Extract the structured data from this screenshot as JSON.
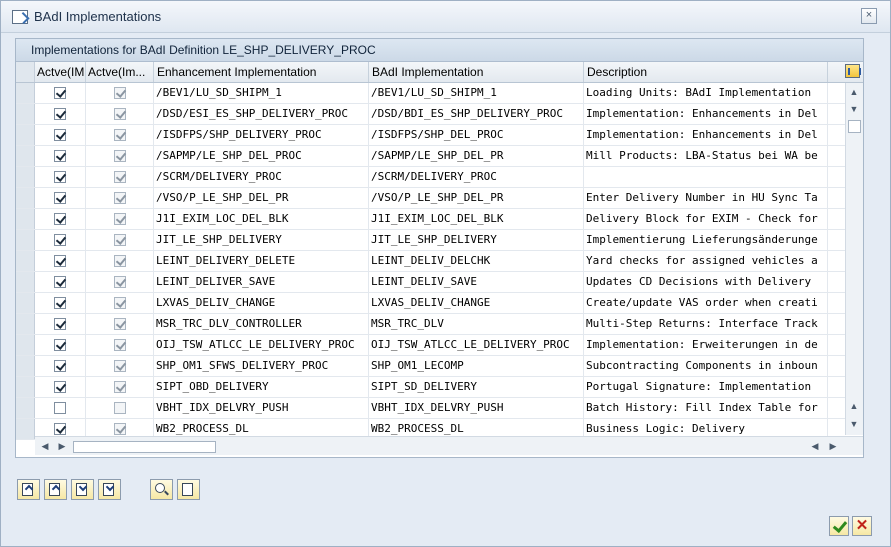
{
  "window": {
    "title": "BAdI Implementations",
    "close_label": "×"
  },
  "panel": {
    "header": "Implementations for BAdI Definition LE_SHP_DELIVERY_PROC"
  },
  "columns": {
    "active_img": "Actve(IMG)",
    "active_im": "Actve(Im...",
    "enhancement": "Enhancement Implementation",
    "badi": "BAdI Implementation",
    "description": "Description"
  },
  "rows": [
    {
      "img": true,
      "im": true,
      "enh": "/BEV1/LU_SD_SHIPM_1",
      "badi": "/BEV1/LU_SD_SHIPM_1",
      "desc": "Loading Units: BAdI Implementation"
    },
    {
      "img": true,
      "im": true,
      "enh": "/DSD/ESI_ES_SHP_DELIVERY_PROC",
      "badi": "/DSD/BDI_ES_SHP_DELIVERY_PROC",
      "desc": "Implementation: Enhancements in Del"
    },
    {
      "img": true,
      "im": true,
      "enh": "/ISDFPS/SHP_DELIVERY_PROC",
      "badi": "/ISDFPS/SHP_DEL_PROC",
      "desc": "Implementation: Enhancements in Del"
    },
    {
      "img": true,
      "im": true,
      "enh": "/SAPMP/LE_SHP_DEL_PROC",
      "badi": "/SAPMP/LE_SHP_DEL_PR",
      "desc": "Mill Products: LBA-Status bei WA be"
    },
    {
      "img": true,
      "im": true,
      "enh": "/SCRM/DELIVERY_PROC",
      "badi": "/SCRM/DELIVERY_PROC",
      "desc": ""
    },
    {
      "img": true,
      "im": true,
      "enh": "/VSO/P_LE_SHP_DEL_PR",
      "badi": "/VSO/P_LE_SHP_DEL_PR",
      "desc": "Enter Delivery Number in HU Sync Ta"
    },
    {
      "img": true,
      "im": true,
      "enh": "J1I_EXIM_LOC_DEL_BLK",
      "badi": "J1I_EXIM_LOC_DEL_BLK",
      "desc": "Delivery Block for EXIM - Check for"
    },
    {
      "img": true,
      "im": true,
      "enh": "JIT_LE_SHP_DELIVERY",
      "badi": "JIT_LE_SHP_DELIVERY",
      "desc": "Implementierung Lieferungsänderunge"
    },
    {
      "img": true,
      "im": true,
      "enh": "LEINT_DELIVERY_DELETE",
      "badi": "LEINT_DELIV_DELCHK",
      "desc": "Yard checks for assigned vehicles a"
    },
    {
      "img": true,
      "im": true,
      "enh": "LEINT_DELIVER_SAVE",
      "badi": "LEINT_DELIV_SAVE",
      "desc": "Updates CD Decisions with Delivery"
    },
    {
      "img": true,
      "im": true,
      "enh": "LXVAS_DELIV_CHANGE",
      "badi": "LXVAS_DELIV_CHANGE",
      "desc": "Create/update VAS order when creati"
    },
    {
      "img": true,
      "im": true,
      "enh": "MSR_TRC_DLV_CONTROLLER",
      "badi": "MSR_TRC_DLV",
      "desc": "Multi-Step Returns: Interface Track"
    },
    {
      "img": true,
      "im": true,
      "enh": "OIJ_TSW_ATLCC_LE_DELIVERY_PROC",
      "badi": "OIJ_TSW_ATLCC_LE_DELIVERY_PROC",
      "desc": "Implementation: Erweiterungen in de"
    },
    {
      "img": true,
      "im": true,
      "enh": "SHP_OM1_SFWS_DELIVERY_PROC",
      "badi": "SHP_OM1_LECOMP",
      "desc": "Subcontracting Components in inboun"
    },
    {
      "img": true,
      "im": true,
      "enh": "SIPT_OBD_DELIVERY",
      "badi": "SIPT_SD_DELIVERY",
      "desc": "Portugal Signature: Implementation"
    },
    {
      "img": false,
      "im": false,
      "enh": "VBHT_IDX_DELVRY_PUSH",
      "badi": "VBHT_IDX_DELVRY_PUSH",
      "desc": "Batch History: Fill Index Table for"
    },
    {
      "img": true,
      "im": true,
      "enh": "WB2_PROCESS_DL",
      "badi": "WB2_PROCESS_DL",
      "desc": "Business Logic: Delivery"
    }
  ]
}
